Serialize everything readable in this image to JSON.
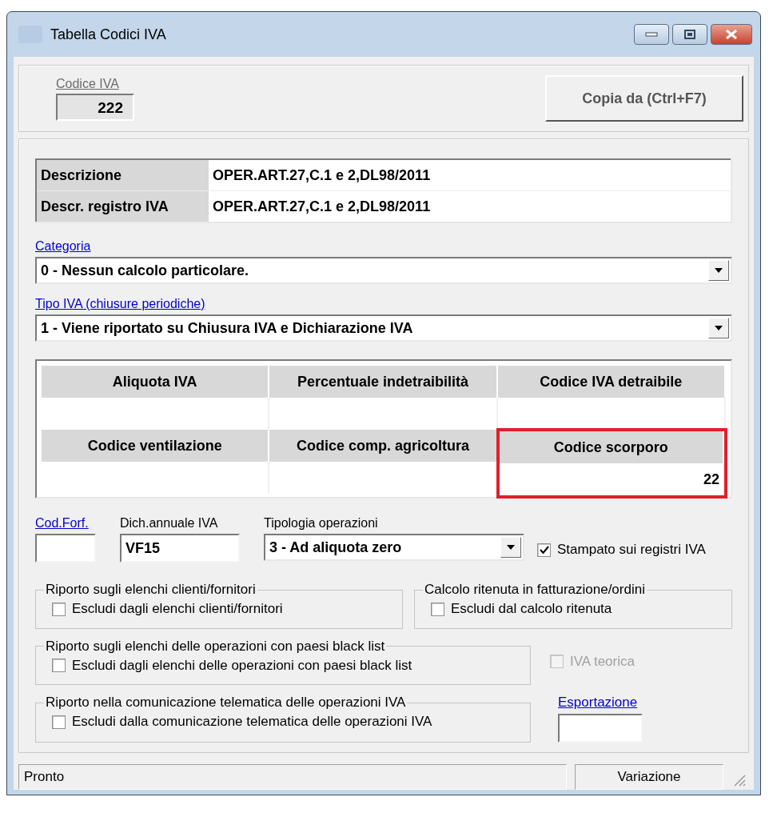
{
  "window": {
    "title": "Tabella Codici IVA"
  },
  "codice_iva": {
    "label": "Codice IVA",
    "value": "222"
  },
  "copy_button": "Copia da (Ctrl+F7)",
  "description_rows": [
    {
      "label": "Descrizione",
      "value": "OPER.ART.27,C.1 e 2,DL98/2011"
    },
    {
      "label": "Descr. registro IVA",
      "value": "OPER.ART.27,C.1 e 2,DL98/2011"
    }
  ],
  "categoria": {
    "label": "Categoria",
    "value": "0 - Nessun calcolo particolare."
  },
  "tipo_iva": {
    "label": "Tipo IVA (chiusure periodiche)",
    "value": "1 - Viene riportato su Chiusura IVA e Dichiarazione IVA"
  },
  "rate_grid": [
    {
      "header": "Aliquota IVA",
      "highlighted": false
    },
    {
      "header": "Percentuale indetraibilità",
      "highlighted": false
    },
    {
      "header": "Codice IVA detraibile",
      "highlighted": false
    },
    {
      "header": "Codice ventilazione",
      "highlighted": false
    },
    {
      "header": "Codice comp. agricoltura",
      "highlighted": false
    },
    {
      "header": "Codice scorporo",
      "value": "22",
      "highlighted": true
    }
  ],
  "cod_forf": {
    "label": "Cod.Forf."
  },
  "dich_annuale": {
    "label": "Dich.annuale IVA",
    "value": "VF15"
  },
  "tipologia": {
    "label": "Tipologia operazioni",
    "value": "3 - Ad aliquota zero"
  },
  "stampato": {
    "label": "Stampato sui registri IVA",
    "checked": true
  },
  "groups": [
    {
      "title": "Riporto sugli elenchi clienti/fornitori",
      "checkbox": {
        "label": "Escludi dagli elenchi clienti/fornitori",
        "checked": false
      }
    },
    {
      "title": "Calcolo ritenuta in fatturazione/ordini",
      "checkbox": {
        "label": "Escludi dal calcolo ritenuta",
        "checked": false
      }
    },
    {
      "title": "Riporto sugli elenchi delle operazioni con paesi black list",
      "checkbox": {
        "label": "Escludi dagli elenchi delle operazioni con paesi black list",
        "checked": false
      }
    },
    {
      "title": "Riporto nella comunicazione telematica delle operazioni IVA",
      "checkbox": {
        "label": "Escludi dalla comunicazione telematica delle operazioni IVA",
        "checked": false
      }
    }
  ],
  "iva_teorica": {
    "label": "IVA teorica",
    "checked": false,
    "disabled": true
  },
  "esportazione": {
    "label": "Esportazione"
  },
  "status_bar": {
    "message": "Pronto",
    "mode": "Variazione"
  }
}
